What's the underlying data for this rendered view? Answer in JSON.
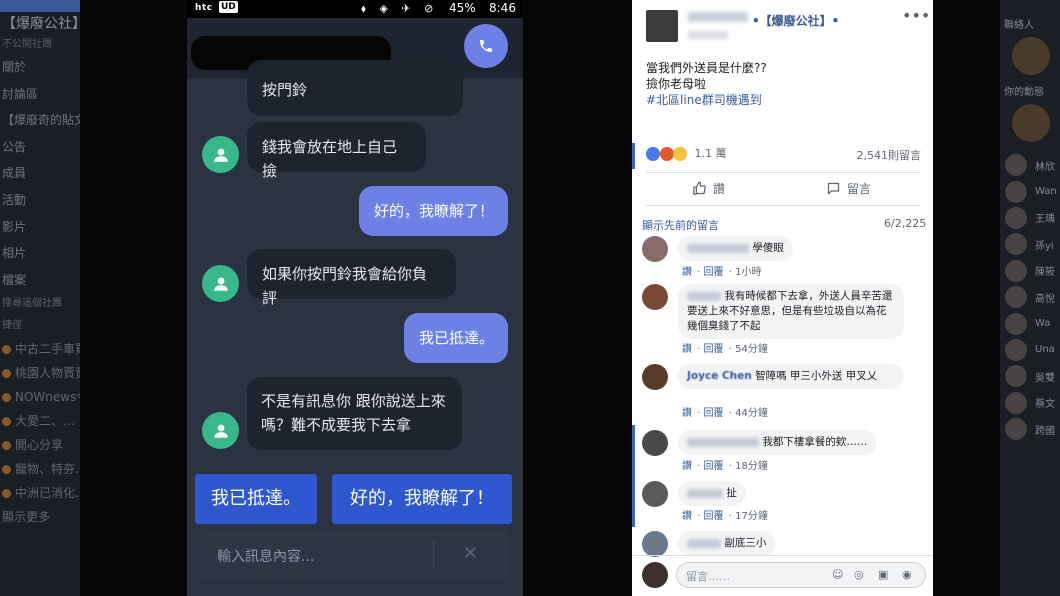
{
  "bg_left": {
    "title": "【爆廢公社】",
    "subtitle": "不公開社團",
    "menu": [
      "關於",
      "討論區",
      "【爆廢奇的貼文】",
      "公告",
      "成員",
      "活動",
      "影片",
      "相片",
      "檔案"
    ],
    "search_label": "搜尋這個社團",
    "shortcuts_label": "捷徑",
    "feed": [
      "中古二手車買賣",
      "桃園人物賣賣",
      "NOWnews今日新聞",
      "大愛二、…",
      "開心分享",
      "寵物、特夯…",
      "中洲已消化…",
      "顯示更多"
    ]
  },
  "bg_right": {
    "header": "聯絡人",
    "section": "你的動態",
    "contacts": [
      "林欣",
      "Wan",
      "王瑀",
      "孫yi",
      "陳筱",
      "高悅",
      "Wa",
      "Una",
      "吳雙",
      "蔡文",
      "跨國"
    ]
  },
  "phone": {
    "status": {
      "brand": "htc",
      "carrier": "UD",
      "icons": "⬧ ◈ ✈ ⊘",
      "battery": "45%",
      "time": "8:46"
    },
    "messages": [
      {
        "side": "in",
        "text": "按門鈴"
      },
      {
        "side": "in",
        "text": "錢我會放在地上自己撿"
      },
      {
        "side": "out",
        "text": "好的，我瞭解了！"
      },
      {
        "side": "in",
        "text": "如果你按門鈴我會給你負評"
      },
      {
        "side": "out",
        "text": "我已抵達。"
      },
      {
        "side": "in",
        "text": "不是有訊息你 跟你說送上來嗎？難不成要我下去拿"
      }
    ],
    "quick_replies": [
      "我已抵達。",
      "好的，我瞭解了！"
    ],
    "input_placeholder": "輸入訊息內容...",
    "clear_icon": "✕"
  },
  "post": {
    "group_name": "•【爆廢公社】•",
    "more": "•••",
    "lines": [
      "當我們外送員是什麼??",
      "撿你老母啦"
    ],
    "hashtag": "#北區line群司機遇到",
    "reactions_count": "1.1 萬",
    "comments_count": "2,541則留言",
    "like_label": "讚",
    "comment_label": "留言",
    "view_more": "顯示先前的留言",
    "page_count": "6/2,225",
    "comments": [
      {
        "text": "學傻眼",
        "time": "1小時"
      },
      {
        "text": "我有時候都下去拿，外送人員辛苦還要送上來不好意思，但是有些垃圾自以為花幾個臭錢了不起",
        "time": "54分鐘"
      },
      {
        "name": "Joyce Chen",
        "text": "智障嗎 甲三小外送 甲叉乂",
        "time": "44分鐘"
      },
      {
        "text": "我都下樓拿餐的欸……",
        "time": "18分鐘"
      },
      {
        "text": "扯",
        "time": "17分鐘"
      },
      {
        "text": "副底三小",
        "time": ""
      }
    ],
    "like_action": "讚",
    "reply_action": "回覆",
    "comment_placeholder": "留言……"
  }
}
